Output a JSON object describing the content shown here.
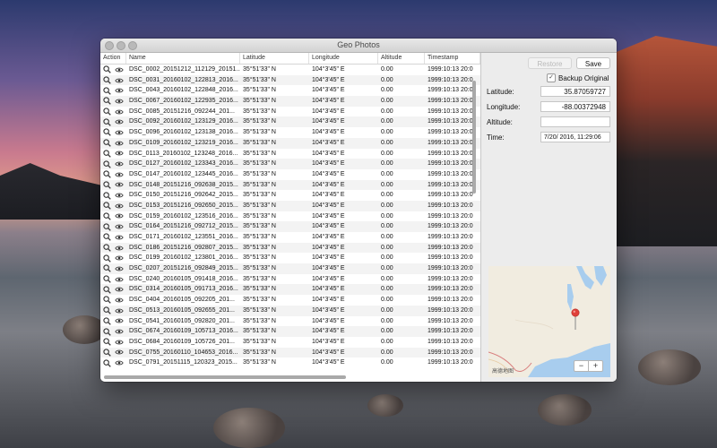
{
  "window": {
    "title": "Geo Photos"
  },
  "table": {
    "columns": [
      "Action",
      "Name",
      "Latitude",
      "Longitude",
      "Altitude",
      "Timestamp"
    ],
    "rows": [
      {
        "name": "DSC_0002_20151212_112129_20151...",
        "lat": "35°51'33\" N",
        "lon": "104°3'45\" E",
        "alt": "0.00",
        "ts": "1999:10:13 20:0"
      },
      {
        "name": "DSC_0031_20160102_122813_2016...",
        "lat": "35°51'33\" N",
        "lon": "104°3'45\" E",
        "alt": "0.00",
        "ts": "1999:10:13 20:0"
      },
      {
        "name": "DSC_0043_20160102_122848_2016...",
        "lat": "35°51'33\" N",
        "lon": "104°3'45\" E",
        "alt": "0.00",
        "ts": "1999:10:13 20:0"
      },
      {
        "name": "DSC_0067_20160102_122935_2016...",
        "lat": "35°51'33\" N",
        "lon": "104°3'45\" E",
        "alt": "0.00",
        "ts": "1999:10:13 20:0"
      },
      {
        "name": "DSC_0085_20151216_092244_201...",
        "lat": "35°51'33\" N",
        "lon": "104°3'45\" E",
        "alt": "0.00",
        "ts": "1999:10:13 20:0"
      },
      {
        "name": "DSC_0092_20160102_123129_2016...",
        "lat": "35°51'33\" N",
        "lon": "104°3'45\" E",
        "alt": "0.00",
        "ts": "1999:10:13 20:0"
      },
      {
        "name": "DSC_0096_20160102_123138_2016...",
        "lat": "35°51'33\" N",
        "lon": "104°3'45\" E",
        "alt": "0.00",
        "ts": "1999:10:13 20:0"
      },
      {
        "name": "DSC_0109_20160102_123219_2016...",
        "lat": "35°51'33\" N",
        "lon": "104°3'45\" E",
        "alt": "0.00",
        "ts": "1999:10:13 20:0"
      },
      {
        "name": "DSC_0113_20160102_123248_2016...",
        "lat": "35°51'33\" N",
        "lon": "104°3'45\" E",
        "alt": "0.00",
        "ts": "1999:10:13 20:0"
      },
      {
        "name": "DSC_0127_20160102_123343_2016...",
        "lat": "35°51'33\" N",
        "lon": "104°3'45\" E",
        "alt": "0.00",
        "ts": "1999:10:13 20:0"
      },
      {
        "name": "DSC_0147_20160102_123445_2016...",
        "lat": "35°51'33\" N",
        "lon": "104°3'45\" E",
        "alt": "0.00",
        "ts": "1999:10:13 20:0"
      },
      {
        "name": "DSC_0148_20151216_092638_2015...",
        "lat": "35°51'33\" N",
        "lon": "104°3'45\" E",
        "alt": "0.00",
        "ts": "1999:10:13 20:0"
      },
      {
        "name": "DSC_0150_20151216_092642_2015...",
        "lat": "35°51'33\" N",
        "lon": "104°3'45\" E",
        "alt": "0.00",
        "ts": "1999:10:13 20:0"
      },
      {
        "name": "DSC_0153_20151216_092650_2015...",
        "lat": "35°51'33\" N",
        "lon": "104°3'45\" E",
        "alt": "0.00",
        "ts": "1999:10:13 20:0"
      },
      {
        "name": "DSC_0159_20160102_123516_2016...",
        "lat": "35°51'33\" N",
        "lon": "104°3'45\" E",
        "alt": "0.00",
        "ts": "1999:10:13 20:0"
      },
      {
        "name": "DSC_0164_20151216_092712_2015...",
        "lat": "35°51'33\" N",
        "lon": "104°3'45\" E",
        "alt": "0.00",
        "ts": "1999:10:13 20:0"
      },
      {
        "name": "DSC_0171_20160102_123551_2016...",
        "lat": "35°51'33\" N",
        "lon": "104°3'45\" E",
        "alt": "0.00",
        "ts": "1999:10:13 20:0"
      },
      {
        "name": "DSC_0186_20151216_092807_2015...",
        "lat": "35°51'33\" N",
        "lon": "104°3'45\" E",
        "alt": "0.00",
        "ts": "1999:10:13 20:0"
      },
      {
        "name": "DSC_0199_20160102_123801_2016...",
        "lat": "35°51'33\" N",
        "lon": "104°3'45\" E",
        "alt": "0.00",
        "ts": "1999:10:13 20:0"
      },
      {
        "name": "DSC_0207_20151216_092849_2015...",
        "lat": "35°51'33\" N",
        "lon": "104°3'45\" E",
        "alt": "0.00",
        "ts": "1999:10:13 20:0"
      },
      {
        "name": "DSC_0240_20160105_091418_2016...",
        "lat": "35°51'33\" N",
        "lon": "104°3'45\" E",
        "alt": "0.00",
        "ts": "1999:10:13 20:0"
      },
      {
        "name": "DSC_0314_20160105_091713_2016...",
        "lat": "35°51'33\" N",
        "lon": "104°3'45\" E",
        "alt": "0.00",
        "ts": "1999:10:13 20:0"
      },
      {
        "name": "DSC_0404_20160105_092205_201...",
        "lat": "35°51'33\" N",
        "lon": "104°3'45\" E",
        "alt": "0.00",
        "ts": "1999:10:13 20:0"
      },
      {
        "name": "DSC_0513_20160105_092655_201...",
        "lat": "35°51'33\" N",
        "lon": "104°3'45\" E",
        "alt": "0.00",
        "ts": "1999:10:13 20:0"
      },
      {
        "name": "DSC_0541_20160105_092820_201...",
        "lat": "35°51'33\" N",
        "lon": "104°3'45\" E",
        "alt": "0.00",
        "ts": "1999:10:13 20:0"
      },
      {
        "name": "DSC_0674_20160109_105713_2016...",
        "lat": "35°51'33\" N",
        "lon": "104°3'45\" E",
        "alt": "0.00",
        "ts": "1999:10:13 20:0"
      },
      {
        "name": "DSC_0684_20160109_105726_201...",
        "lat": "35°51'33\" N",
        "lon": "104°3'45\" E",
        "alt": "0.00",
        "ts": "1999:10:13 20:0"
      },
      {
        "name": "DSC_0755_20160110_104653_2016...",
        "lat": "35°51'33\" N",
        "lon": "104°3'45\" E",
        "alt": "0.00",
        "ts": "1999:10:13 20:0"
      },
      {
        "name": "DSC_0791_20151115_120323_2015...",
        "lat": "35°51'33\" N",
        "lon": "104°3'45\" E",
        "alt": "0.00",
        "ts": "1999:10:13 20:0"
      }
    ]
  },
  "panel": {
    "restore_label": "Restore",
    "save_label": "Save",
    "backup_label": "Backup Original",
    "backup_checked_glyph": "✓",
    "latitude_label": "Latitude:",
    "latitude_value": "35.87059727",
    "longitude_label": "Longitude:",
    "longitude_value": "-88.00372948",
    "altitude_label": "Altitude:",
    "altitude_value": "",
    "time_label": "Time:",
    "time_value": "7/20/ 2016,  11:29:06",
    "map_legal": "高德地图",
    "zoom_out": "−",
    "zoom_in": "+"
  },
  "icons": {
    "row_actions": [
      "magnifier-icon",
      "eye-icon"
    ]
  }
}
